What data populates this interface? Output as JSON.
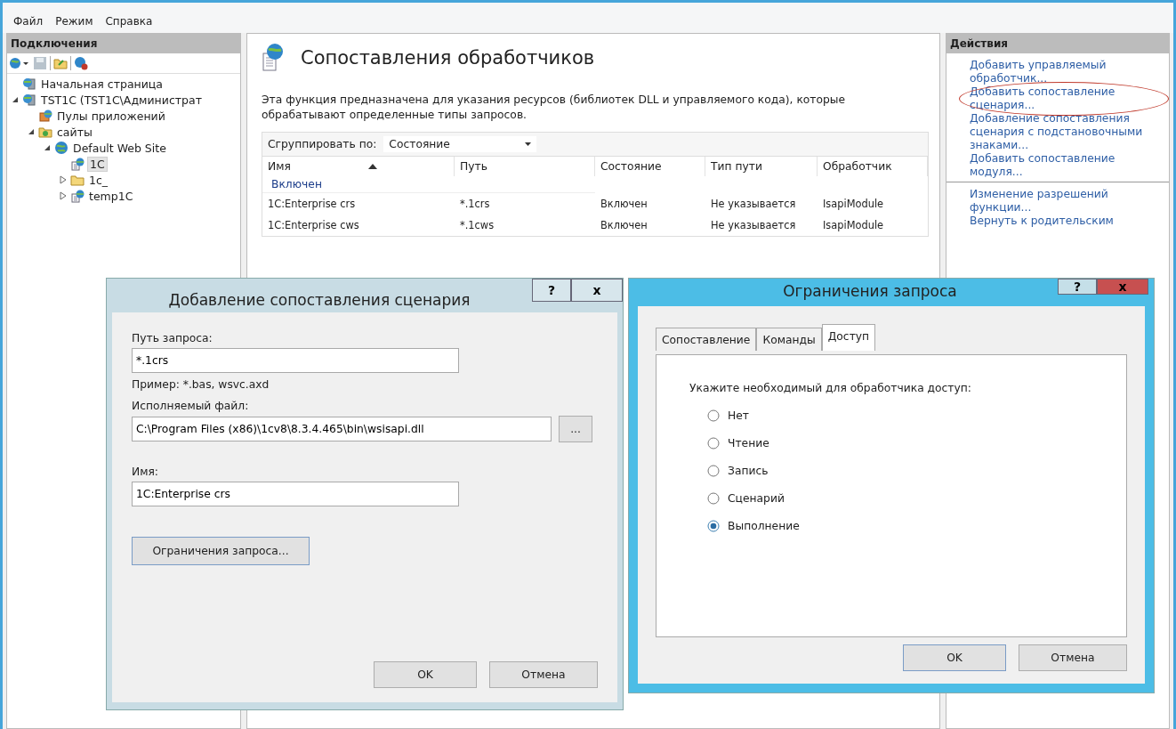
{
  "menu": [
    "Файл",
    "Режим",
    "Справка"
  ],
  "connections": {
    "title": "Подключения",
    "tree": [
      {
        "label": "Начальная страница",
        "kind": "server",
        "selected": false
      },
      {
        "label": "TST1C (TST1C\\Администрат",
        "kind": "server",
        "selected": false,
        "expanded": true,
        "children": [
          {
            "label": "Пулы приложений",
            "kind": "pool",
            "selected": false
          },
          {
            "label": "сайты",
            "kind": "sites",
            "selected": false,
            "expanded": true,
            "children": [
              {
                "label": "Default Web Site",
                "kind": "globe",
                "selected": false,
                "expanded": true,
                "children": [
                  {
                    "label": "1C",
                    "kind": "app",
                    "selected": true
                  },
                  {
                    "label": "1c_",
                    "kind": "folder",
                    "selected": false,
                    "expanded": false
                  },
                  {
                    "label": "temp1C",
                    "kind": "app",
                    "selected": false,
                    "expanded": false
                  }
                ]
              }
            ]
          }
        ]
      }
    ]
  },
  "feature": {
    "title": "Сопоставления обработчиков",
    "description": "Эта функция предназначена для указания ресурсов (библиотек DLL и управляемого кода), которые обрабатывают определенные типы запросов.",
    "group_by": {
      "label": "Сгруппировать по:",
      "value": "Состояние"
    },
    "columns": [
      "Имя",
      "Путь",
      "Состояние",
      "Тип пути",
      "Обработчик"
    ],
    "groups": [
      {
        "name": "Включен",
        "rows": [
          [
            "1C:Enterprise crs",
            "*.1crs",
            "Включен",
            "Не указывается",
            "IsapiModule"
          ],
          [
            "1C:Enterprise cws",
            "*.1cws",
            "Включен",
            "Не указывается",
            "IsapiModule"
          ]
        ]
      }
    ]
  },
  "actions": {
    "title": "Действия",
    "groups": [
      [
        {
          "label": "Добавить управляемый обработчик...",
          "highlighted": false
        },
        {
          "label": "Добавить сопоставление сценария...",
          "highlighted": true
        },
        {
          "label": "Добавление сопоставления сценария с подстановочными знаками...",
          "highlighted": false
        },
        {
          "label": "Добавить сопоставление модуля...",
          "highlighted": false
        }
      ],
      [
        {
          "label": "Изменение разрешений функции...",
          "highlighted": false
        },
        {
          "label": "Вернуть к родительским",
          "highlighted": false
        }
      ]
    ]
  },
  "script_dialog": {
    "title": "Добавление сопоставления сценария",
    "help": "?",
    "close": "x",
    "path_label": "Путь запроса:",
    "path_value": "*.1crs",
    "example": "Пример: *.bas, wsvc.axd",
    "exe_label": "Исполняемый файл:",
    "exe_value": "C:\\Program Files (x86)\\1cv8\\8.3.4.465\\bin\\wsisapi.dll",
    "browse": "...",
    "name_label": "Имя:",
    "name_value": "1C:Enterprise crs",
    "restrictions_button": "Ограничения запроса...",
    "ok": "OK",
    "cancel": "Отмена"
  },
  "restrictions_dialog": {
    "title": "Ограничения запроса",
    "help": "?",
    "close": "x",
    "tabs": [
      {
        "label": "Сопоставление",
        "selected": false
      },
      {
        "label": "Команды",
        "selected": false
      },
      {
        "label": "Доступ",
        "selected": true
      }
    ],
    "prompt": "Укажите необходимый для обработчика доступ:",
    "options": [
      {
        "label": "Нет",
        "selected": false
      },
      {
        "label": "Чтение",
        "selected": false
      },
      {
        "label": "Запись",
        "selected": false
      },
      {
        "label": "Сценарий",
        "selected": false
      },
      {
        "label": "Выполнение",
        "selected": true
      }
    ],
    "ok": "OK",
    "cancel": "Отмена"
  }
}
